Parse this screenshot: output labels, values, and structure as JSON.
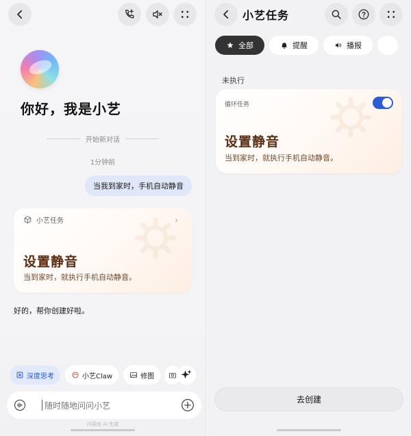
{
  "left": {
    "greeting": "你好，我是小艺",
    "new_conversation": "开始新对话",
    "time_label": "1分钟前",
    "user_message": "当我到家时，手机自动静音",
    "task_card": {
      "header": "小艺任务",
      "title": "设置静音",
      "description": "当到家时，就执行手机自动静音。"
    },
    "reply": "好的，帮你创建好啦。",
    "chips": [
      {
        "label": "深度思考",
        "icon": "deep-think-icon"
      },
      {
        "label": "小艺Claw",
        "icon": "claw-icon"
      },
      {
        "label": "修图",
        "icon": "image-edit-icon"
      }
    ],
    "input_placeholder": "随时随地问问小艺",
    "ai_note": "内容由 AI 生成",
    "colors": {
      "accent": "#2a57c9",
      "card_title": "#5a2d10"
    }
  },
  "right": {
    "title": "小艺任务",
    "tabs": [
      {
        "label": "全部",
        "icon": "star-icon",
        "active": true
      },
      {
        "label": "提醒",
        "icon": "bell-icon",
        "active": false
      },
      {
        "label": "播报",
        "icon": "speaker-icon",
        "active": false
      }
    ],
    "section": "未执行",
    "card": {
      "repeat_label": "循环任务",
      "toggle_on": true,
      "title": "设置静音",
      "description": "当到家时，就执行手机自动静音。"
    },
    "create_button": "去创建"
  }
}
